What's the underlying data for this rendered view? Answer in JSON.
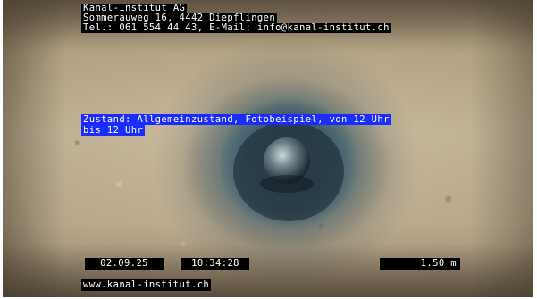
{
  "header": {
    "company": "Kanal-Institut AG",
    "address": "Sommerauweg 16, 4442 Diepflingen",
    "contact": "Tel.: 061 554 44 43, E-Mail: info@kanal-institut.ch"
  },
  "condition": {
    "line1": "Zustand: Allgemeinzustand, Fotobeispiel, von 12 Uhr",
    "line2": "bis 12 Uhr"
  },
  "footer": {
    "date": "02.09.25",
    "time": "10:34:28",
    "distance": "1.50 m",
    "website": "www.kanal-institut.ch"
  },
  "colors": {
    "overlay_background": "#000000",
    "overlay_text": "#ffffff",
    "condition_highlight": "#1b2cff"
  }
}
